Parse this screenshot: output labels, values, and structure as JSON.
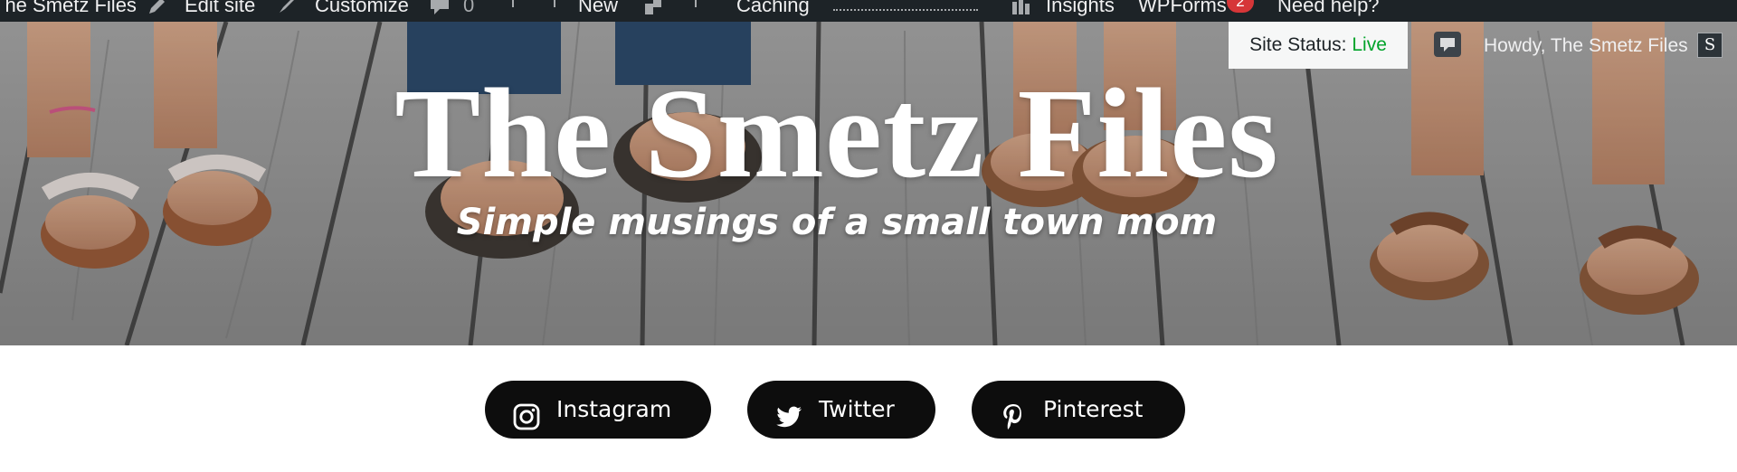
{
  "admin_bar": {
    "site_name": "The Smetz Files",
    "edit_site": "Edit site",
    "customize": "Customize",
    "comments_count": "0",
    "new": "New",
    "caching": "Caching",
    "insights": "Insights",
    "wpforms": "WPForms",
    "wpforms_badge": "2",
    "help": "Need help?",
    "site_status_label": "Site Status:",
    "site_status_value": "Live",
    "howdy": "Howdy, The Smetz Files",
    "avatar_letter": "S"
  },
  "header": {
    "site_title": "The Smetz Files",
    "tagline": "Simple musings of a small town mom"
  },
  "socials": [
    {
      "label": "Instagram",
      "icon": "instagram-icon"
    },
    {
      "label": "Twitter",
      "icon": "twitter-icon"
    },
    {
      "label": "Pinterest",
      "icon": "pinterest-icon"
    }
  ],
  "colors": {
    "admin_bar_bg": "#1d2327",
    "status_live": "#00a32a",
    "badge": "#d63638",
    "button_bg": "#0d0d0d"
  }
}
